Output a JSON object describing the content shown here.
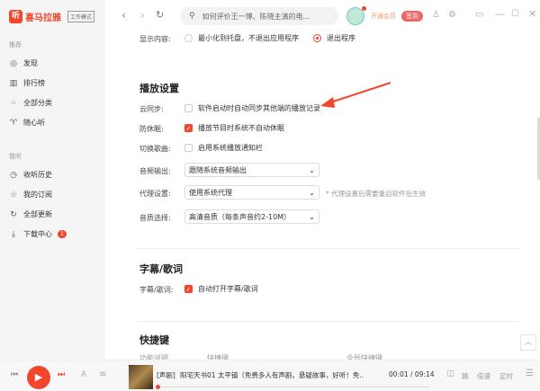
{
  "app": {
    "logo_text": "喜马拉雅",
    "logo_glyph": "听",
    "mode_badge": "工作模式"
  },
  "sidebar": {
    "section1": "推荐",
    "items1": [
      {
        "icon": "compass-icon",
        "glyph": "◎",
        "label": "发现"
      },
      {
        "icon": "chart-icon",
        "glyph": "▥",
        "label": "排行榜"
      },
      {
        "icon": "grid-icon",
        "glyph": "⁘",
        "label": "全部分类"
      },
      {
        "icon": "radio-icon",
        "glyph": "♈",
        "label": "随心听"
      }
    ],
    "section2": "我听",
    "items2": [
      {
        "icon": "clock-icon",
        "glyph": "◷",
        "label": "收听历史"
      },
      {
        "icon": "star-icon",
        "glyph": "☆",
        "label": "我的订阅"
      },
      {
        "icon": "refresh-icon",
        "glyph": "↻",
        "label": "全部更新"
      },
      {
        "icon": "download-icon",
        "glyph": "⤓",
        "label": "下载中心",
        "badge": "1"
      }
    ]
  },
  "header": {
    "search_placeholder": "如何评价王一博、陈晓主演的电...",
    "vip": "开通会员",
    "signin": "签到"
  },
  "settings": {
    "display_label": "显示内容:",
    "display_opt1": "最小化到托盘，不退出应用程序",
    "display_opt2": "退出程序",
    "play_title": "播放设置",
    "cloud_label": "云同步:",
    "cloud_text": "软件启动时自动同步其他端的播放记录",
    "cloud_checked": false,
    "sleep_label": "防休眠:",
    "sleep_text": "播放节目时系统不自动休眠",
    "sleep_checked": true,
    "switch_label": "切换歌曲:",
    "switch_text": "启用系统播放通知栏",
    "switch_checked": false,
    "audio_label": "音频输出:",
    "audio_value": "跟随系统音频输出",
    "proxy_label": "代理设置:",
    "proxy_value": "使用系统代理",
    "proxy_note": "* 代理设置后需要重启软件后生效",
    "quality_label": "音质选择:",
    "quality_value": "高清音质（每条声音约2-10M）",
    "lyrics_title": "字幕/歌词",
    "lyrics_label": "字幕/歌词:",
    "lyrics_text": "自动打开字幕/歌词",
    "lyrics_checked": true,
    "hotkey_title": "快捷键",
    "hotkey_cols": [
      "功能说明",
      "快捷键",
      "全局快捷键"
    ]
  },
  "player": {
    "tag": "[声剧]",
    "title": "阳宅天书01 太平镇（免费多人有声剧，悬疑故事，好听！免...",
    "time": "00:01 / 09:14",
    "progress": 0.002,
    "skip": "跳",
    "speed": "倍速",
    "timer": "定时"
  },
  "colors": {
    "accent": "#f3442c"
  }
}
